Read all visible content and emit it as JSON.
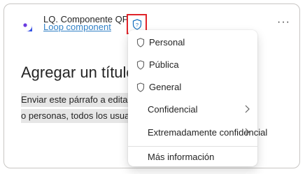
{
  "component": {
    "title": "LQ. Componente QP",
    "subtitle": "Loop component",
    "more_label": "···"
  },
  "content": {
    "heading": "Agregar un título",
    "paragraph_line_1": "Enviar este párrafo a editar",
    "paragraph_line_2": "o personas, todos los usuarios"
  },
  "sensitivity_menu": {
    "items": [
      {
        "label": "Personal",
        "icon": "shield-icon"
      },
      {
        "label": "Pública",
        "icon": "shield-icon"
      },
      {
        "label": "General",
        "icon": "shield-icon"
      },
      {
        "label": "Confidencial",
        "icon": "chevron-right-icon"
      },
      {
        "label": "Extremadamente confidencial",
        "icon": "chevron-right-icon"
      }
    ],
    "more_info": "Más información"
  },
  "colors": {
    "highlight_border": "#e0242a",
    "link": "#0f6cbd",
    "shield_icon": "#0f6cbd"
  }
}
